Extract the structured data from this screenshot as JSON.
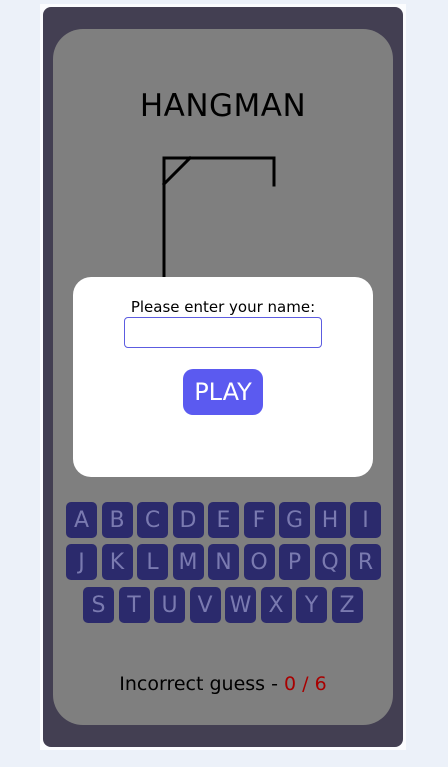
{
  "game": {
    "title": "HANGMAN"
  },
  "modal": {
    "prompt": "Please enter your name:",
    "name_value": "",
    "play_label": "PLAY"
  },
  "keyboard": {
    "rows": [
      [
        "A",
        "B",
        "C",
        "D",
        "E",
        "F",
        "G",
        "H",
        "I"
      ],
      [
        "J",
        "K",
        "L",
        "M",
        "N",
        "O",
        "P",
        "Q",
        "R"
      ],
      [
        "S",
        "T",
        "U",
        "V",
        "W",
        "X",
        "Y",
        "Z"
      ]
    ]
  },
  "status": {
    "label": "Incorrect guess - ",
    "count": "0 / 6"
  },
  "colors": {
    "page_bg": "#ecf1f9",
    "outer_bg": "#433f52",
    "board_bg": "#7f7f7f",
    "key_bg": "#2b2a6c",
    "key_text": "#7a7ab0",
    "play_bg": "#5b5af0",
    "count_color": "#a80000"
  }
}
